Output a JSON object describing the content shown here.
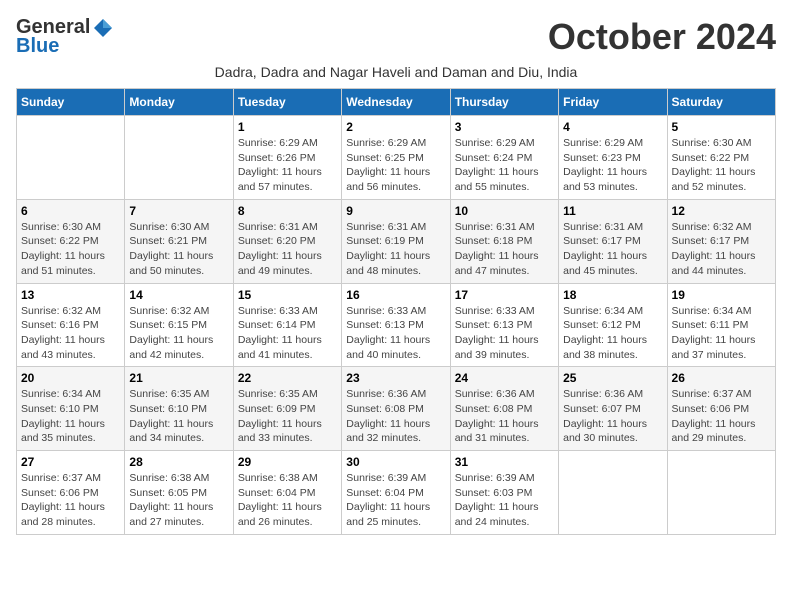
{
  "logo": {
    "general": "General",
    "blue": "Blue"
  },
  "title": "October 2024",
  "subtitle": "Dadra, Dadra and Nagar Haveli and Daman and Diu, India",
  "weekdays": [
    "Sunday",
    "Monday",
    "Tuesday",
    "Wednesday",
    "Thursday",
    "Friday",
    "Saturday"
  ],
  "weeks": [
    [
      {
        "day": null,
        "info": null
      },
      {
        "day": null,
        "info": null
      },
      {
        "day": "1",
        "info": "Sunrise: 6:29 AM\nSunset: 6:26 PM\nDaylight: 11 hours and 57 minutes."
      },
      {
        "day": "2",
        "info": "Sunrise: 6:29 AM\nSunset: 6:25 PM\nDaylight: 11 hours and 56 minutes."
      },
      {
        "day": "3",
        "info": "Sunrise: 6:29 AM\nSunset: 6:24 PM\nDaylight: 11 hours and 55 minutes."
      },
      {
        "day": "4",
        "info": "Sunrise: 6:29 AM\nSunset: 6:23 PM\nDaylight: 11 hours and 53 minutes."
      },
      {
        "day": "5",
        "info": "Sunrise: 6:30 AM\nSunset: 6:22 PM\nDaylight: 11 hours and 52 minutes."
      }
    ],
    [
      {
        "day": "6",
        "info": "Sunrise: 6:30 AM\nSunset: 6:22 PM\nDaylight: 11 hours and 51 minutes."
      },
      {
        "day": "7",
        "info": "Sunrise: 6:30 AM\nSunset: 6:21 PM\nDaylight: 11 hours and 50 minutes."
      },
      {
        "day": "8",
        "info": "Sunrise: 6:31 AM\nSunset: 6:20 PM\nDaylight: 11 hours and 49 minutes."
      },
      {
        "day": "9",
        "info": "Sunrise: 6:31 AM\nSunset: 6:19 PM\nDaylight: 11 hours and 48 minutes."
      },
      {
        "day": "10",
        "info": "Sunrise: 6:31 AM\nSunset: 6:18 PM\nDaylight: 11 hours and 47 minutes."
      },
      {
        "day": "11",
        "info": "Sunrise: 6:31 AM\nSunset: 6:17 PM\nDaylight: 11 hours and 45 minutes."
      },
      {
        "day": "12",
        "info": "Sunrise: 6:32 AM\nSunset: 6:17 PM\nDaylight: 11 hours and 44 minutes."
      }
    ],
    [
      {
        "day": "13",
        "info": "Sunrise: 6:32 AM\nSunset: 6:16 PM\nDaylight: 11 hours and 43 minutes."
      },
      {
        "day": "14",
        "info": "Sunrise: 6:32 AM\nSunset: 6:15 PM\nDaylight: 11 hours and 42 minutes."
      },
      {
        "day": "15",
        "info": "Sunrise: 6:33 AM\nSunset: 6:14 PM\nDaylight: 11 hours and 41 minutes."
      },
      {
        "day": "16",
        "info": "Sunrise: 6:33 AM\nSunset: 6:13 PM\nDaylight: 11 hours and 40 minutes."
      },
      {
        "day": "17",
        "info": "Sunrise: 6:33 AM\nSunset: 6:13 PM\nDaylight: 11 hours and 39 minutes."
      },
      {
        "day": "18",
        "info": "Sunrise: 6:34 AM\nSunset: 6:12 PM\nDaylight: 11 hours and 38 minutes."
      },
      {
        "day": "19",
        "info": "Sunrise: 6:34 AM\nSunset: 6:11 PM\nDaylight: 11 hours and 37 minutes."
      }
    ],
    [
      {
        "day": "20",
        "info": "Sunrise: 6:34 AM\nSunset: 6:10 PM\nDaylight: 11 hours and 35 minutes."
      },
      {
        "day": "21",
        "info": "Sunrise: 6:35 AM\nSunset: 6:10 PM\nDaylight: 11 hours and 34 minutes."
      },
      {
        "day": "22",
        "info": "Sunrise: 6:35 AM\nSunset: 6:09 PM\nDaylight: 11 hours and 33 minutes."
      },
      {
        "day": "23",
        "info": "Sunrise: 6:36 AM\nSunset: 6:08 PM\nDaylight: 11 hours and 32 minutes."
      },
      {
        "day": "24",
        "info": "Sunrise: 6:36 AM\nSunset: 6:08 PM\nDaylight: 11 hours and 31 minutes."
      },
      {
        "day": "25",
        "info": "Sunrise: 6:36 AM\nSunset: 6:07 PM\nDaylight: 11 hours and 30 minutes."
      },
      {
        "day": "26",
        "info": "Sunrise: 6:37 AM\nSunset: 6:06 PM\nDaylight: 11 hours and 29 minutes."
      }
    ],
    [
      {
        "day": "27",
        "info": "Sunrise: 6:37 AM\nSunset: 6:06 PM\nDaylight: 11 hours and 28 minutes."
      },
      {
        "day": "28",
        "info": "Sunrise: 6:38 AM\nSunset: 6:05 PM\nDaylight: 11 hours and 27 minutes."
      },
      {
        "day": "29",
        "info": "Sunrise: 6:38 AM\nSunset: 6:04 PM\nDaylight: 11 hours and 26 minutes."
      },
      {
        "day": "30",
        "info": "Sunrise: 6:39 AM\nSunset: 6:04 PM\nDaylight: 11 hours and 25 minutes."
      },
      {
        "day": "31",
        "info": "Sunrise: 6:39 AM\nSunset: 6:03 PM\nDaylight: 11 hours and 24 minutes."
      },
      {
        "day": null,
        "info": null
      },
      {
        "day": null,
        "info": null
      }
    ]
  ]
}
